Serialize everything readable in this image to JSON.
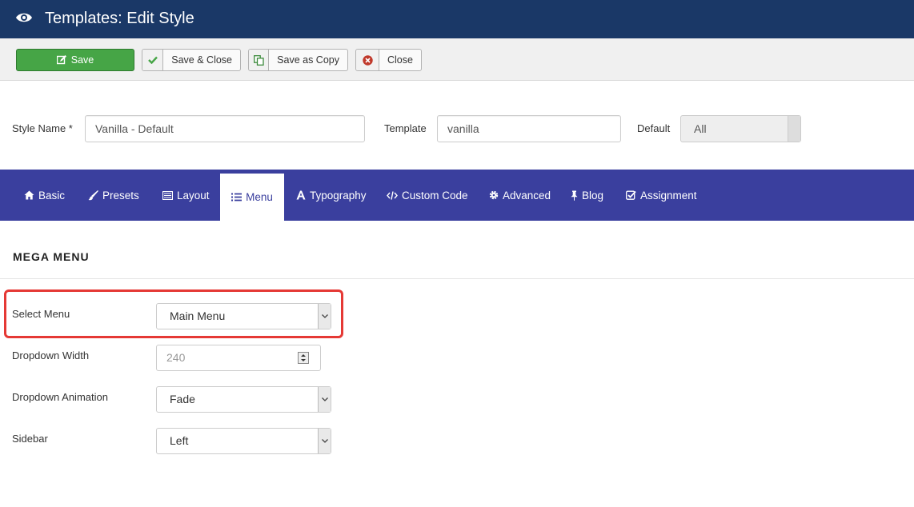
{
  "header": {
    "title": "Templates: Edit Style",
    "icon": "eye-icon"
  },
  "toolbar": {
    "save": "Save",
    "save_close": "Save & Close",
    "save_copy": "Save as Copy",
    "close": "Close"
  },
  "form": {
    "style_name_label": "Style Name *",
    "style_name_value": "Vanilla - Default",
    "template_label": "Template",
    "template_value": "vanilla",
    "default_label": "Default",
    "default_value": "All"
  },
  "tabs": [
    {
      "label": "Basic",
      "icon": "home-icon"
    },
    {
      "label": "Presets",
      "icon": "brush-icon"
    },
    {
      "label": "Layout",
      "icon": "layout-icon"
    },
    {
      "label": "Menu",
      "icon": "list-icon",
      "active": true
    },
    {
      "label": "Typography",
      "icon": "font-icon"
    },
    {
      "label": "Custom Code",
      "icon": "code-icon"
    },
    {
      "label": "Advanced",
      "icon": "gear-icon"
    },
    {
      "label": "Blog",
      "icon": "pin-icon"
    },
    {
      "label": "Assignment",
      "icon": "check-square-icon"
    }
  ],
  "section": {
    "title": "MEGA MENU",
    "fields": {
      "select_menu": {
        "label": "Select Menu",
        "value": "Main Menu"
      },
      "dropdown_width": {
        "label": "Dropdown Width",
        "value": "240"
      },
      "dropdown_animation": {
        "label": "Dropdown Animation",
        "value": "Fade"
      },
      "sidebar": {
        "label": "Sidebar",
        "value": "Left"
      }
    }
  },
  "colors": {
    "header_bg": "#1a3867",
    "tabbar_bg": "#3a3f9e",
    "save_green": "#46a546",
    "highlight_red": "#e53935"
  }
}
